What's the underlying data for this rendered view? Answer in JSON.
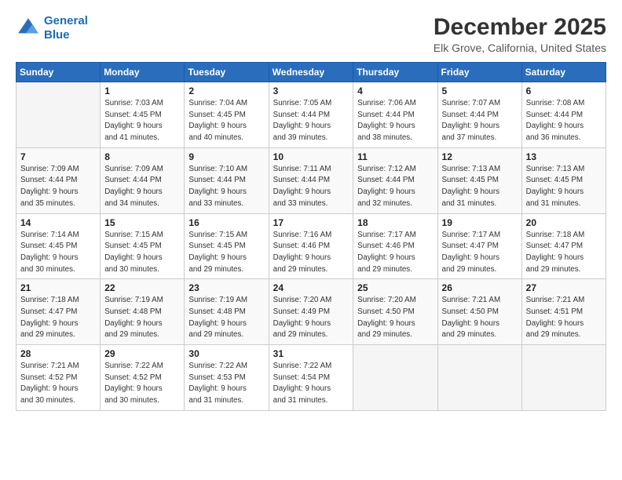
{
  "header": {
    "logo_line1": "General",
    "logo_line2": "Blue",
    "title": "December 2025",
    "subtitle": "Elk Grove, California, United States"
  },
  "days_of_week": [
    "Sunday",
    "Monday",
    "Tuesday",
    "Wednesday",
    "Thursday",
    "Friday",
    "Saturday"
  ],
  "weeks": [
    [
      {
        "day": "",
        "sunrise": "",
        "sunset": "",
        "daylight": ""
      },
      {
        "day": "1",
        "sunrise": "Sunrise: 7:03 AM",
        "sunset": "Sunset: 4:45 PM",
        "daylight": "Daylight: 9 hours and 41 minutes."
      },
      {
        "day": "2",
        "sunrise": "Sunrise: 7:04 AM",
        "sunset": "Sunset: 4:45 PM",
        "daylight": "Daylight: 9 hours and 40 minutes."
      },
      {
        "day": "3",
        "sunrise": "Sunrise: 7:05 AM",
        "sunset": "Sunset: 4:44 PM",
        "daylight": "Daylight: 9 hours and 39 minutes."
      },
      {
        "day": "4",
        "sunrise": "Sunrise: 7:06 AM",
        "sunset": "Sunset: 4:44 PM",
        "daylight": "Daylight: 9 hours and 38 minutes."
      },
      {
        "day": "5",
        "sunrise": "Sunrise: 7:07 AM",
        "sunset": "Sunset: 4:44 PM",
        "daylight": "Daylight: 9 hours and 37 minutes."
      },
      {
        "day": "6",
        "sunrise": "Sunrise: 7:08 AM",
        "sunset": "Sunset: 4:44 PM",
        "daylight": "Daylight: 9 hours and 36 minutes."
      }
    ],
    [
      {
        "day": "7",
        "sunrise": "Sunrise: 7:09 AM",
        "sunset": "Sunset: 4:44 PM",
        "daylight": "Daylight: 9 hours and 35 minutes."
      },
      {
        "day": "8",
        "sunrise": "Sunrise: 7:09 AM",
        "sunset": "Sunset: 4:44 PM",
        "daylight": "Daylight: 9 hours and 34 minutes."
      },
      {
        "day": "9",
        "sunrise": "Sunrise: 7:10 AM",
        "sunset": "Sunset: 4:44 PM",
        "daylight": "Daylight: 9 hours and 33 minutes."
      },
      {
        "day": "10",
        "sunrise": "Sunrise: 7:11 AM",
        "sunset": "Sunset: 4:44 PM",
        "daylight": "Daylight: 9 hours and 33 minutes."
      },
      {
        "day": "11",
        "sunrise": "Sunrise: 7:12 AM",
        "sunset": "Sunset: 4:44 PM",
        "daylight": "Daylight: 9 hours and 32 minutes."
      },
      {
        "day": "12",
        "sunrise": "Sunrise: 7:13 AM",
        "sunset": "Sunset: 4:45 PM",
        "daylight": "Daylight: 9 hours and 31 minutes."
      },
      {
        "day": "13",
        "sunrise": "Sunrise: 7:13 AM",
        "sunset": "Sunset: 4:45 PM",
        "daylight": "Daylight: 9 hours and 31 minutes."
      }
    ],
    [
      {
        "day": "14",
        "sunrise": "Sunrise: 7:14 AM",
        "sunset": "Sunset: 4:45 PM",
        "daylight": "Daylight: 9 hours and 30 minutes."
      },
      {
        "day": "15",
        "sunrise": "Sunrise: 7:15 AM",
        "sunset": "Sunset: 4:45 PM",
        "daylight": "Daylight: 9 hours and 30 minutes."
      },
      {
        "day": "16",
        "sunrise": "Sunrise: 7:15 AM",
        "sunset": "Sunset: 4:45 PM",
        "daylight": "Daylight: 9 hours and 29 minutes."
      },
      {
        "day": "17",
        "sunrise": "Sunrise: 7:16 AM",
        "sunset": "Sunset: 4:46 PM",
        "daylight": "Daylight: 9 hours and 29 minutes."
      },
      {
        "day": "18",
        "sunrise": "Sunrise: 7:17 AM",
        "sunset": "Sunset: 4:46 PM",
        "daylight": "Daylight: 9 hours and 29 minutes."
      },
      {
        "day": "19",
        "sunrise": "Sunrise: 7:17 AM",
        "sunset": "Sunset: 4:47 PM",
        "daylight": "Daylight: 9 hours and 29 minutes."
      },
      {
        "day": "20",
        "sunrise": "Sunrise: 7:18 AM",
        "sunset": "Sunset: 4:47 PM",
        "daylight": "Daylight: 9 hours and 29 minutes."
      }
    ],
    [
      {
        "day": "21",
        "sunrise": "Sunrise: 7:18 AM",
        "sunset": "Sunset: 4:47 PM",
        "daylight": "Daylight: 9 hours and 29 minutes."
      },
      {
        "day": "22",
        "sunrise": "Sunrise: 7:19 AM",
        "sunset": "Sunset: 4:48 PM",
        "daylight": "Daylight: 9 hours and 29 minutes."
      },
      {
        "day": "23",
        "sunrise": "Sunrise: 7:19 AM",
        "sunset": "Sunset: 4:48 PM",
        "daylight": "Daylight: 9 hours and 29 minutes."
      },
      {
        "day": "24",
        "sunrise": "Sunrise: 7:20 AM",
        "sunset": "Sunset: 4:49 PM",
        "daylight": "Daylight: 9 hours and 29 minutes."
      },
      {
        "day": "25",
        "sunrise": "Sunrise: 7:20 AM",
        "sunset": "Sunset: 4:50 PM",
        "daylight": "Daylight: 9 hours and 29 minutes."
      },
      {
        "day": "26",
        "sunrise": "Sunrise: 7:21 AM",
        "sunset": "Sunset: 4:50 PM",
        "daylight": "Daylight: 9 hours and 29 minutes."
      },
      {
        "day": "27",
        "sunrise": "Sunrise: 7:21 AM",
        "sunset": "Sunset: 4:51 PM",
        "daylight": "Daylight: 9 hours and 29 minutes."
      }
    ],
    [
      {
        "day": "28",
        "sunrise": "Sunrise: 7:21 AM",
        "sunset": "Sunset: 4:52 PM",
        "daylight": "Daylight: 9 hours and 30 minutes."
      },
      {
        "day": "29",
        "sunrise": "Sunrise: 7:22 AM",
        "sunset": "Sunset: 4:52 PM",
        "daylight": "Daylight: 9 hours and 30 minutes."
      },
      {
        "day": "30",
        "sunrise": "Sunrise: 7:22 AM",
        "sunset": "Sunset: 4:53 PM",
        "daylight": "Daylight: 9 hours and 31 minutes."
      },
      {
        "day": "31",
        "sunrise": "Sunrise: 7:22 AM",
        "sunset": "Sunset: 4:54 PM",
        "daylight": "Daylight: 9 hours and 31 minutes."
      },
      {
        "day": "",
        "sunrise": "",
        "sunset": "",
        "daylight": ""
      },
      {
        "day": "",
        "sunrise": "",
        "sunset": "",
        "daylight": ""
      },
      {
        "day": "",
        "sunrise": "",
        "sunset": "",
        "daylight": ""
      }
    ]
  ]
}
